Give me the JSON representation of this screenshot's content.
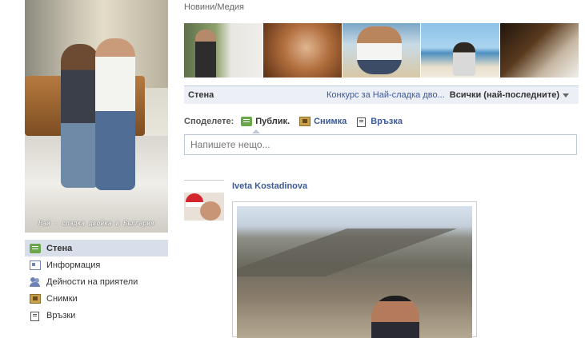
{
  "profile": {
    "caption": "Най - сладка двойка в България"
  },
  "sidebar": {
    "items": [
      {
        "label": "Стена",
        "icon": "wall-icon",
        "active": true
      },
      {
        "label": "Информация",
        "icon": "info-icon"
      },
      {
        "label": "Дейности на приятели",
        "icon": "friends-icon"
      },
      {
        "label": "Снимки",
        "icon": "photos-icon"
      },
      {
        "label": "Връзки",
        "icon": "links-icon"
      }
    ]
  },
  "header": {
    "breadcrumb": "Новини/Медия"
  },
  "wall": {
    "title": "Стена",
    "contest_link": "Конкурс за Най-сладка дво...",
    "filter": "Всички (най-последните)"
  },
  "share": {
    "label": "Споделете:",
    "options": [
      {
        "label": "Публик.",
        "icon": "status-icon",
        "active": true
      },
      {
        "label": "Снимка",
        "icon": "photo-icon"
      },
      {
        "label": "Връзка",
        "icon": "link-icon"
      }
    ]
  },
  "composer": {
    "placeholder": "Напишете нещо..."
  },
  "post": {
    "author": "Iveta Kostadinova"
  },
  "colors": {
    "link": "#3b5998",
    "active_nav_bg": "#d8dfea",
    "bar_bg": "#eceff5"
  }
}
